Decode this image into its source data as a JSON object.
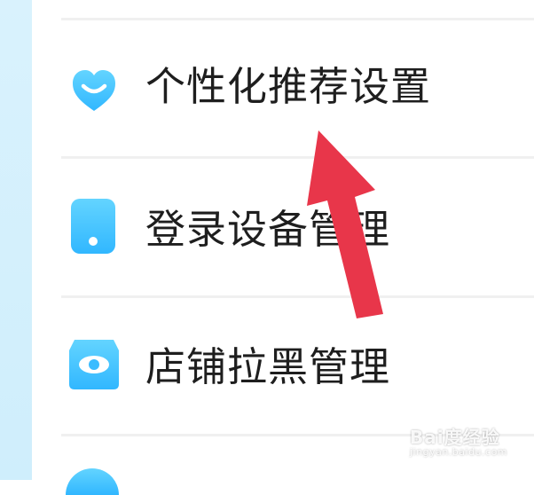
{
  "menu": {
    "items": [
      {
        "label": "个性化推荐设置",
        "icon": "heart-smile-icon"
      },
      {
        "label": "登录设备管理",
        "icon": "phone-icon"
      },
      {
        "label": "店铺拉黑管理",
        "icon": "shop-eye-icon"
      }
    ]
  },
  "watermark": {
    "brand": "Bai度经验",
    "sub": "jingyan.baidu.com"
  },
  "colors": {
    "icon_blue_top": "#63d4ff",
    "icon_blue_bottom": "#31b7ff",
    "arrow": "#e8364a",
    "left_strip": "#d9f2fd"
  }
}
